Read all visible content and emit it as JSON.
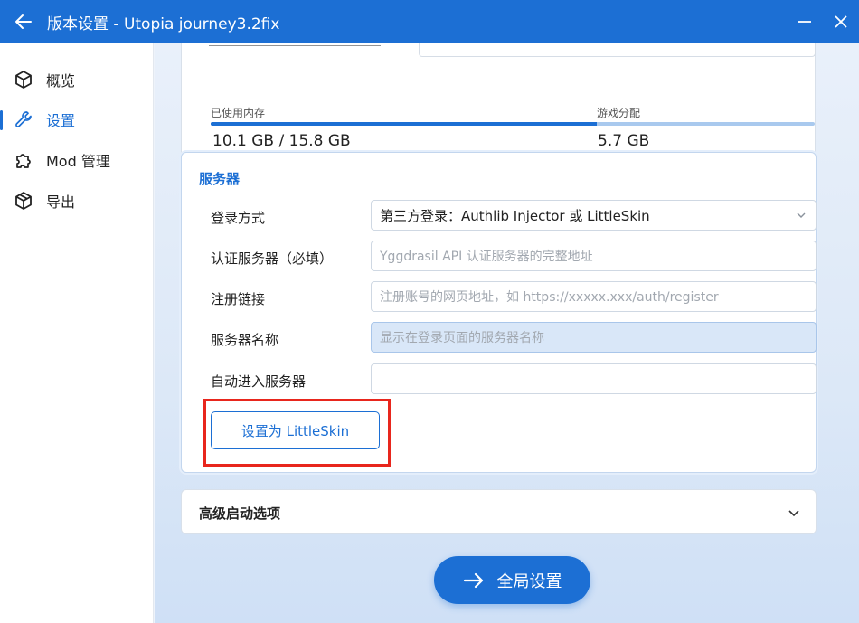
{
  "window": {
    "title": "版本设置 - Utopia journey3.2fix"
  },
  "sidebar": {
    "items": [
      {
        "label": "概览",
        "icon": "cube-icon"
      },
      {
        "label": "设置",
        "icon": "wrench-icon",
        "active": true
      },
      {
        "label": "Mod 管理",
        "icon": "puzzle-icon"
      },
      {
        "label": "导出",
        "icon": "box-icon"
      }
    ]
  },
  "memory": {
    "used_label": "已使用内存",
    "used_value": "10.1 GB / 15.8 GB",
    "game_label": "游戏分配",
    "game_value": "5.7 GB",
    "used_fraction": 0.639
  },
  "server": {
    "title": "服务器",
    "login_method_label": "登录方式",
    "login_method_value": "第三方登录：Authlib Injector 或 LittleSkin",
    "auth_server_label": "认证服务器（必填）",
    "auth_server_placeholder": "Yggdrasil API 认证服务器的完整地址",
    "register_link_label": "注册链接",
    "register_link_placeholder": "注册账号的网页地址，如 https://xxxxx.xxx/auth/register",
    "server_name_label": "服务器名称",
    "server_name_placeholder": "显示在登录页面的服务器名称",
    "auto_join_label": "自动进入服务器",
    "auto_join_value": "",
    "set_littleskin_button": "设置为 LittleSkin"
  },
  "advanced": {
    "title": "高级启动选项"
  },
  "global_settings_button": "全局设置",
  "colors": {
    "accent": "#1c6fd4",
    "highlight": "#e8261d"
  }
}
